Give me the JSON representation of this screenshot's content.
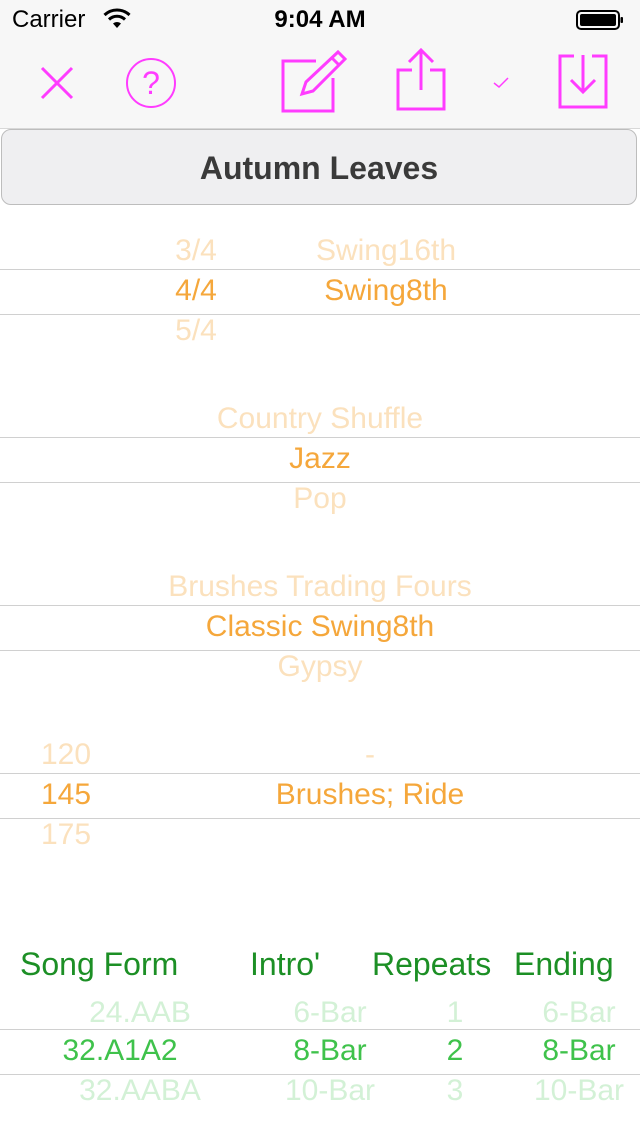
{
  "status_bar": {
    "carrier": "Carrier",
    "time": "9:04 AM"
  },
  "toolbar": {
    "icons": [
      "close-icon",
      "help-icon",
      "edit-icon",
      "share-icon",
      "checkmark-icon",
      "download-icon"
    ],
    "accent_color": "#ff3cff"
  },
  "song": {
    "title": "Autumn Leaves"
  },
  "meter_picker": {
    "above": "3/4",
    "selected": "4/4",
    "below": "5/4"
  },
  "feel_picker": {
    "above": "Swing16th",
    "selected": "Swing8th"
  },
  "genre_picker": {
    "above": "Country Shuffle",
    "selected": "Jazz",
    "below": "Pop"
  },
  "style_picker": {
    "above": "Brushes Trading Fours",
    "selected": "Classic Swing8th",
    "below": "Gypsy"
  },
  "tempo_picker": {
    "above": "120",
    "selected": "145",
    "below": "175"
  },
  "drums_picker": {
    "above": "-",
    "selected": "Brushes; Ride"
  },
  "form_headers": {
    "song_form": "Song Form",
    "intro": "Intro'",
    "repeats": "Repeats",
    "ending": "Ending"
  },
  "song_form_picker": {
    "above": "24.AAB",
    "selected": "32.A1A2",
    "below": "32.AABA"
  },
  "intro_picker": {
    "above": "6-Bar",
    "selected": "8-Bar",
    "below": "10-Bar"
  },
  "repeats_picker": {
    "above": "1",
    "selected": "2",
    "below": "3"
  },
  "ending_picker": {
    "above": "6-Bar",
    "selected": "8-Bar",
    "below": "10-Bar"
  },
  "colors": {
    "picker_selected": "#f5a73b",
    "picker_dim": "#fbe1bd",
    "form_header": "#1c8f25",
    "form_selected": "#3fc24b"
  }
}
